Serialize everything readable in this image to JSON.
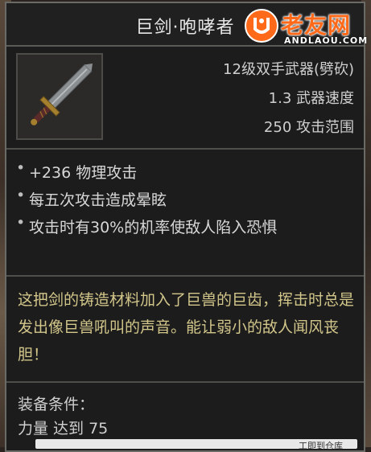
{
  "item": {
    "name": "巨剑·咆哮者",
    "type": "12级双手武器(劈砍)",
    "speed": "1.3 武器速度",
    "range": "250 攻击范围"
  },
  "effects": [
    "+236 物理攻击",
    "每五次攻击造成晕眩",
    "攻击时有30%的机率使敌人陷入恐惧"
  ],
  "lore": "这把剑的铸造材料加入了巨兽的巨齿，挥击时总是发出像巨兽吼叫的声音。能让弱小的敌人闻风丧胆！",
  "requirements": {
    "title": "装备条件：",
    "strength": "力量 达到 75"
  },
  "watermark": {
    "text": "老友网",
    "sub": "ANDLAOU.COM"
  },
  "footer": {
    "hint": "工即到仓库"
  }
}
